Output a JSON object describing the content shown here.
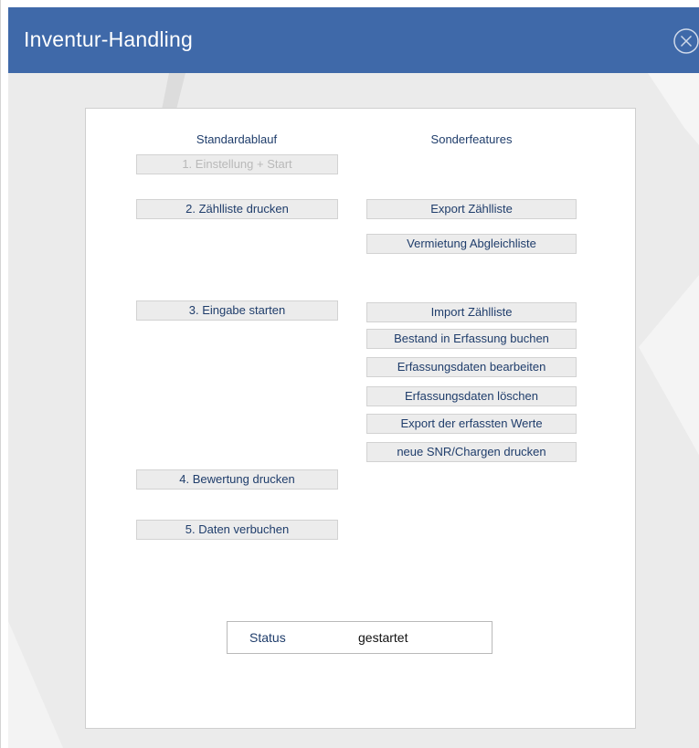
{
  "window": {
    "title": "Inventur-Handling",
    "close_icon": "close-circle-icon"
  },
  "columns": {
    "standard_heading": "Standardablauf",
    "special_heading": "Sonderfeatures"
  },
  "standard_buttons": {
    "setup_start": "1. Einstellung + Start",
    "print_count_list": "2. Zählliste drucken",
    "start_entry": "3. Eingabe starten",
    "print_valuation": "4. Bewertung drucken",
    "post_data": "5. Daten verbuchen"
  },
  "special_buttons": {
    "export_count_list": "Export Zählliste",
    "rental_reconciliation": "Vermietung Abgleichliste",
    "import_count_list": "Import Zählliste",
    "book_stock": "Bestand in Erfassung buchen",
    "edit_entry_data": "Erfassungsdaten bearbeiten",
    "delete_entry_data": "Erfassungsdaten löschen",
    "export_entered_values": "Export der erfassten Werte",
    "print_serial_batches": "neue SNR/Chargen drucken"
  },
  "status": {
    "label": "Status",
    "value": "gestartet"
  },
  "colors": {
    "titlebar": "#3f69a9",
    "button_bg": "#ececec",
    "button_text": "#1f3d6b",
    "disabled_text": "#b9b9b9"
  }
}
